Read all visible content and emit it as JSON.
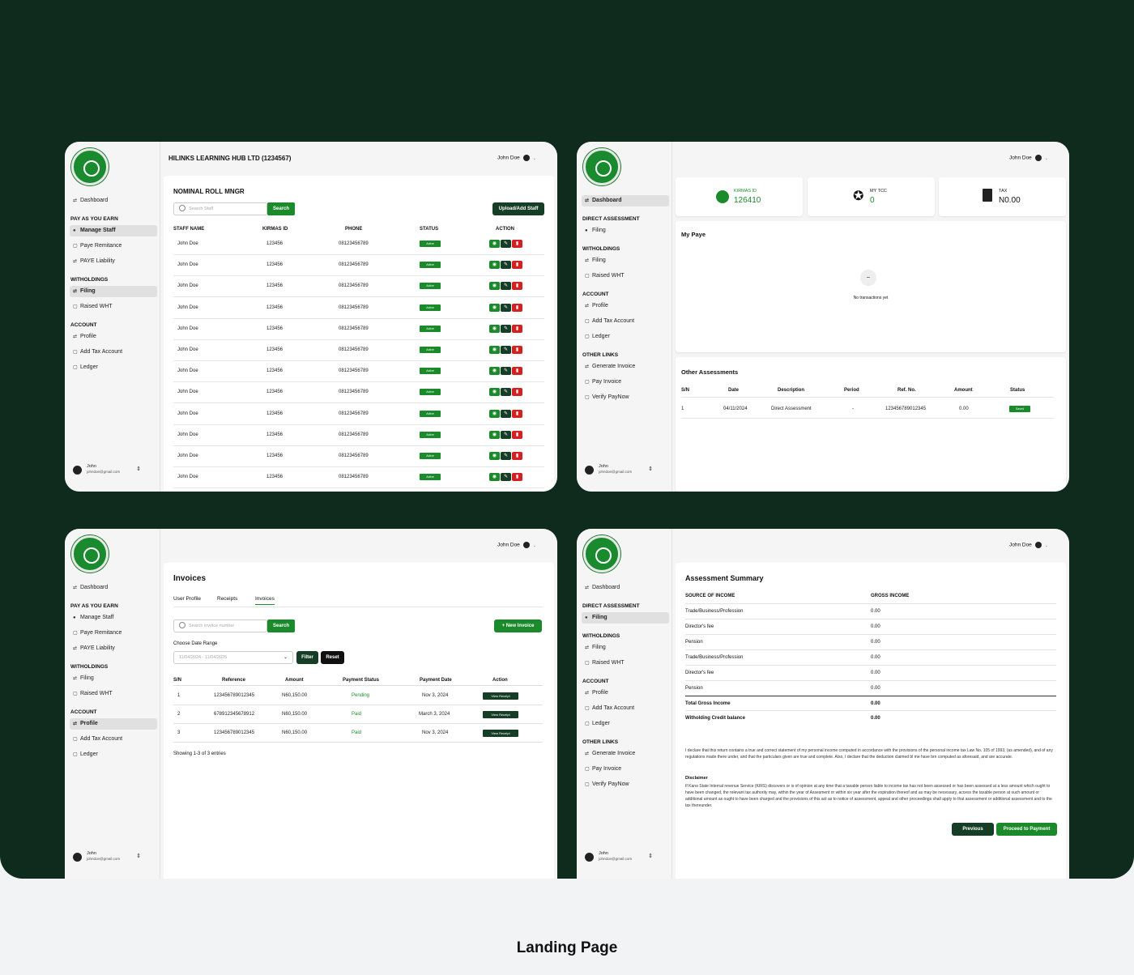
{
  "caption": "Landing Page",
  "user": {
    "name": "John Doe",
    "short": "John",
    "email": "johndoe@gmail.com"
  },
  "nav": {
    "dashboard": "Dashboard",
    "paye": "PAY AS YOU EARN",
    "manage": "Manage Staff",
    "remit": "Paye Remitance",
    "liab": "PAYE Liability",
    "with": "WITHOLDINGS",
    "filing": "Filing",
    "raised": "Raised WHT",
    "account": "ACCOUNT",
    "profile": "Profile",
    "addtax": "Add Tax Account",
    "ledger": "Ledger",
    "direct": "DIRECT ASSESSMENT",
    "other": "OTHER LINKS",
    "gen": "Generate Invoice",
    "pay": "Pay Invoice",
    "verify": "Verify PayNow"
  },
  "s1": {
    "company": "HILINKS LEARNING HUB LTD (1234567)",
    "title": "NOMINAL ROLL MNGR",
    "search_ph": "Search Staff",
    "search": "Search",
    "upload": "Upload/Add Staff",
    "cols": [
      "STAFF NAME",
      "KIRMAS ID",
      "PHONE",
      "STATUS",
      "ACTION"
    ],
    "staff": "John Doe",
    "kid": "123456",
    "phone": "08123456789",
    "status": "Active"
  },
  "s2": {
    "k1": "KIRMAS ID",
    "v1": "126410",
    "k2": "MY TCC",
    "v2": "0",
    "k3": "TAX",
    "v3": "N0.00",
    "mypaye": "My Paye",
    "empty": "No transactions yet",
    "other": "Other Assessments",
    "cols": [
      "S/N",
      "Date",
      "Description",
      "Period",
      "Ref. No.",
      "Amount",
      "Status"
    ],
    "row": [
      "1",
      "04/11/2024",
      "Direct Assessment",
      "-",
      "123456789012345",
      "0.00",
      "Saved"
    ]
  },
  "s3": {
    "title": "Invoices",
    "tabs": [
      "User Profile",
      "Receipts",
      "Invoices"
    ],
    "search_ph": "Search invoice number",
    "search": "Search",
    "new": "+ New Invoice",
    "range_label": "Choose Date Range",
    "range": "11/04/2024 - 11/04/2025",
    "filter": "Filter",
    "reset": "Reset",
    "cols": [
      "S/N",
      "Reference",
      "Amount",
      "Payment Status",
      "Payment Date",
      "Action"
    ],
    "rows": [
      [
        "1",
        "123456789012345",
        "N60,150.00",
        "Pending",
        "Nov 3, 2024"
      ],
      [
        "2",
        "678912345678912",
        "N60,150.00",
        "Paid",
        "March 3, 2024"
      ],
      [
        "3",
        "123456789012345",
        "N60,150.00",
        "Paid",
        "Nov 3, 2024"
      ]
    ],
    "view": "View Receipt",
    "showing": "Showing 1-3 of 3 entries"
  },
  "s4": {
    "title": "Assessment Summary",
    "c1": "SOURCE OF INCOME",
    "c2": "GROSS INCOME",
    "rows": [
      [
        "Trade/Business/Profession",
        "0.00"
      ],
      [
        "Director's fee",
        "0.00"
      ],
      [
        "Pension",
        "0.00"
      ],
      [
        "Trade/Business/Profession",
        "0.00"
      ],
      [
        "Director's fee",
        "0.00"
      ],
      [
        "Pension",
        "0.00"
      ]
    ],
    "total": [
      "Total Gross Income",
      "0.00"
    ],
    "wht": [
      "Witholding Credit balance",
      "0.00"
    ],
    "declare": "I declare that this return contains a true and correct statement of my personal income computed in accordance with the provisions of the personal income tax Law No. 105 of 1993, (as amended), and of any regulations made there under, and that the particulars given are true and complete. Also, I declare that the deduction claimed bl me have brn computed as aforesaid, and are accurate.",
    "disc_t": "Disclaimer",
    "disc": "If Kano State Internal revenue Service (KIRS) discovers or is of opinion at any time that a taxable person liable to income tax has not been assessed or has been assessed at a less amount which ought to have been changed, the relevant tax authority may, within the year of Assesment or within six year after the expiration thereof and as may be necessary, access the taxable person at such amount or additional amount as ought to have been charged and the provisions of this act as to notice of assessment, appeal and other proceedings shall apply to that assessment or additional assessment and to the tax thereunder.",
    "prev": "Previous",
    "proceed": "Proceed to Payment"
  }
}
